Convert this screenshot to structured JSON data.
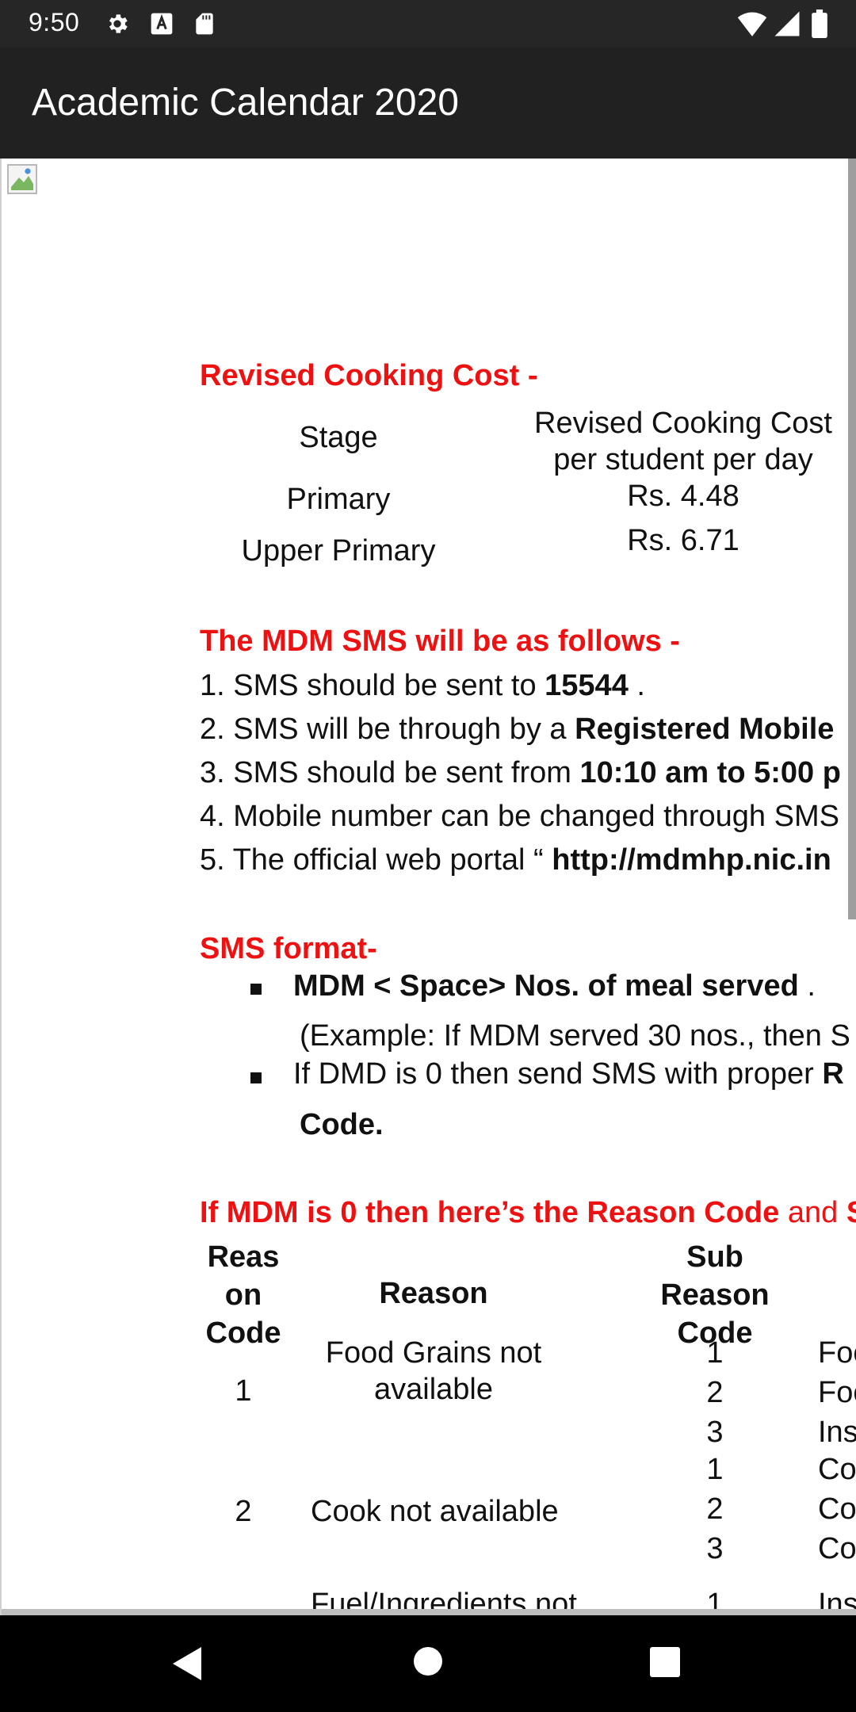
{
  "status_bar": {
    "time": "9:50"
  },
  "app_bar": {
    "title": "Academic Calendar 2020"
  },
  "cooking": {
    "heading": "Revised Cooking Cost -",
    "col_stage": "Stage",
    "col_cost_line1": "Revised Cooking Cost",
    "col_cost_line2": "per student per day",
    "rows": [
      {
        "stage": "Primary",
        "cost": "Rs. 4.48"
      },
      {
        "stage": "Upper Primary",
        "cost": "Rs. 6.71"
      }
    ]
  },
  "sms": {
    "heading": "The MDM SMS will be as follows -",
    "items": [
      {
        "prefix": "1. SMS should be sent to ",
        "bold": "15544",
        "suffix": " ."
      },
      {
        "prefix": "2. SMS will be through by a ",
        "bold": "Registered Mobile",
        "suffix": ""
      },
      {
        "prefix": "3. SMS should be sent from ",
        "bold": "10:10 am to 5:00 p",
        "suffix": ""
      },
      {
        "prefix": "4. Mobile number can be changed through SMS",
        "bold": "",
        "suffix": ""
      },
      {
        "prefix": "5. The official web portal “ ",
        "bold": "http://mdmhp.nic.in",
        "suffix": ""
      }
    ]
  },
  "format": {
    "heading": "SMS format-",
    "bullet1_bold": "MDM < Space> Nos. of meal served",
    "bullet1_suffix": " .",
    "bullet1_example": "(Example: If MDM served 30 nos., then S",
    "bullet2_prefix": "If DMD is 0 then send SMS with proper ",
    "bullet2_bold": "R",
    "bullet2_cont": "Code."
  },
  "reason": {
    "heading_bold": "If MDM is 0 then here’s the Reason Code",
    "heading_normal": " and ",
    "heading_tail": "S",
    "col_code": [
      "Reas",
      "on",
      "Code"
    ],
    "col_reason": "Reason",
    "col_sub": [
      "Sub",
      "Reason",
      "Code"
    ],
    "rows": [
      {
        "code": "1",
        "reason": [
          "Food Grains not",
          "available"
        ],
        "subs": [
          "1",
          "2",
          "3"
        ],
        "sub_text": [
          "Foo",
          "Foo",
          "Ins"
        ]
      },
      {
        "code": "2",
        "reason": [
          "Cook not available"
        ],
        "subs": [
          "1",
          "2",
          "3"
        ],
        "sub_text": [
          "Co",
          "Co",
          "Co"
        ]
      },
      {
        "code": "",
        "reason": [
          "Fuel/Ingredients not"
        ],
        "subs": [
          "1"
        ],
        "sub_text": [
          "Ins"
        ]
      }
    ]
  },
  "colors": {
    "heading_red": "#ee1111",
    "app_bar": "#212121",
    "status_bar": "#262626"
  }
}
